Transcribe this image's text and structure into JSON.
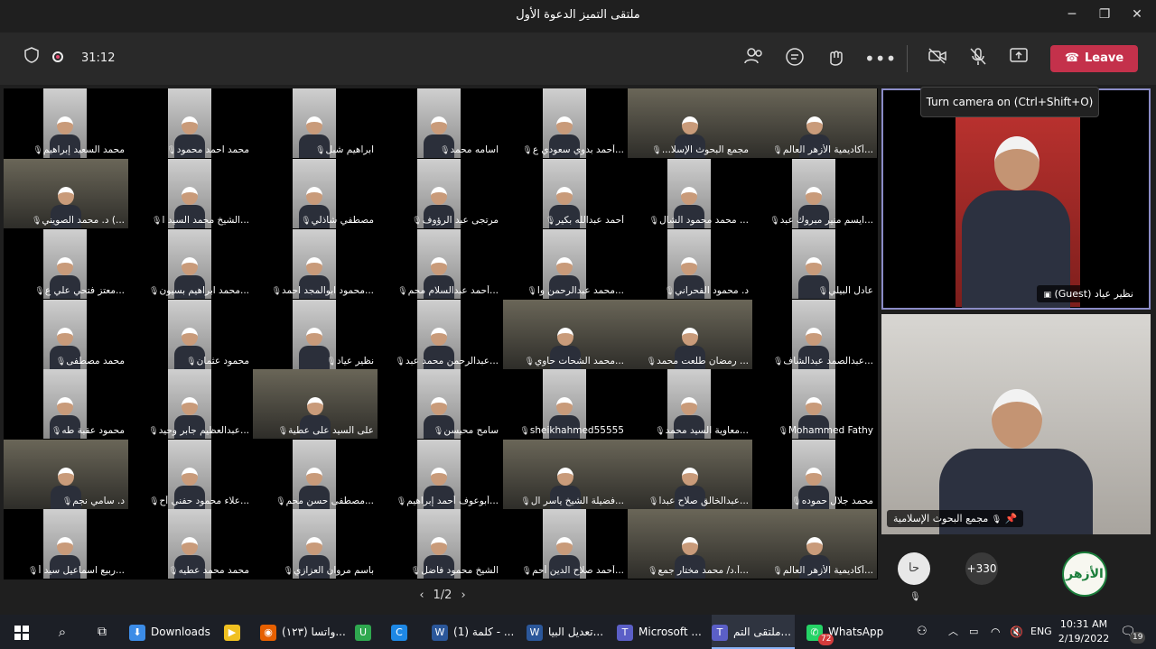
{
  "window": {
    "title": "ملتقى التميز الدعوة الأول",
    "minimize": "─",
    "maximize": "❐",
    "close": "✕"
  },
  "toolbar": {
    "timer": "31:12",
    "leave_label": "Leave",
    "tooltip": "Turn camera on (Ctrl+Shift+O)"
  },
  "grid": {
    "rows": [
      [
        "محمد السعيد إبراهيم",
        "محمد احمد محمود",
        "ابراهيم شبل",
        "اسامه محمد",
        "...أحمد بدوي سعودي ع",
        "مجمع البحوث الإسلا...",
        "...أكاديمية الأزهر العالم"
      ],
      [
        "...) د. محمد الصويني",
        "...الشيخ محمد السيد ا",
        "مصطفي شاذلي",
        "مرتجى عبد الرؤوف",
        "أحمد عبدالله بكير",
        "... محمد محمود الشال",
        "...ايسم منير مبروك عبد"
      ],
      [
        "...معتز فتحي علي ع",
        "...محمد ابراهيم بسيون",
        "...محمود ابوالمجد احمد",
        "...أحمد عبدالسلام محم",
        "...محمد عبدالرحمن وا",
        "د. محمود الفحراني",
        "عادل البيلي"
      ],
      [
        "محمد مصطفى",
        "محمود عثمان",
        "نظير عياد",
        "...عبدالرحمن محمد عبد",
        "...محمد الشحات حاوي",
        "... رمضان طلعت محمد",
        "...عبدالصمد عبدالشاف"
      ],
      [
        "محمود عقبة طه",
        "...عبدالعظيم جابر وحيد",
        "على السيد على عطية",
        "سامح محيسن",
        "sheikhahmed55555",
        "...معاوية السيد محمد",
        "Mohammed Fathy"
      ],
      [
        "د. سامي نجم",
        "...علاء محمود حفني أح",
        "...مصطفى حسن محم",
        "...أبوعوف أحمد إبراهيم",
        "...فضيلة الشيخ ياسر ال",
        "...عبدالخالق صلاح عبدا",
        "محمد جلال حموده"
      ],
      [
        "...ربيع اسماعيل سيد أ",
        "محمد محمد عطيه",
        "باسم مروان العزازي",
        "الشيخ محمود فاضل",
        "...أحمد صلاح الدين أحم",
        "...أ.د/ محمد مختار جمع",
        "...أكاديمية الأزهر العالم"
      ]
    ]
  },
  "spotlight": {
    "main_name": "نظير عياد (Guest)",
    "second_name": "مجمع البحوث الإسلامية"
  },
  "pager": {
    "label": "1/2"
  },
  "roster": {
    "avatar_initials": "حا",
    "more_count": "+330",
    "logo_text": "الأزهر"
  },
  "taskbar": {
    "items": [
      {
        "label": "Downloads",
        "icon": "folder-icon",
        "color": "#3c8ce7"
      },
      {
        "label": "",
        "icon": "player-icon",
        "color": "#f0c020"
      },
      {
        "label": "واتسا (١٢٣)...",
        "icon": "firefox-icon",
        "color": "#e66000"
      },
      {
        "label": "",
        "icon": "u-icon",
        "color": "#2fa84f"
      },
      {
        "label": "",
        "icon": "c-icon",
        "color": "#1e88e5"
      },
      {
        "label": "كلمة (1) - ...",
        "icon": "word-icon",
        "color": "#2b579a"
      },
      {
        "label": "تعديل البيا...",
        "icon": "word-icon",
        "color": "#2b579a"
      },
      {
        "label": "Microsoft ...",
        "icon": "teams-icon",
        "color": "#5b5fc7"
      },
      {
        "label": "ملتقى التم...",
        "icon": "teams-icon",
        "color": "#5b5fc7"
      },
      {
        "label": "WhatsApp",
        "icon": "whatsapp-icon",
        "color": "#25d366"
      }
    ],
    "teams_badge": "72",
    "lang": "ENG",
    "time": "10:31 AM",
    "date": "2/19/2022",
    "notif_count": "19"
  }
}
